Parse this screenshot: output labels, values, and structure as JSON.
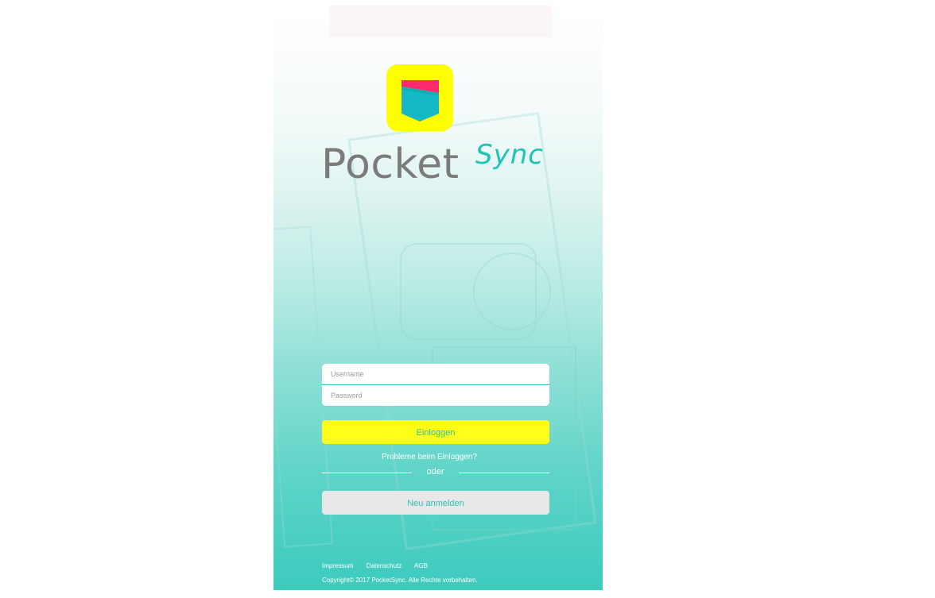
{
  "app": {
    "name_part1": "Pocket",
    "name_part2": "Sync",
    "icon": "pocket-logo-icon"
  },
  "login": {
    "username_placeholder": "Username",
    "password_placeholder": "Password",
    "login_button": "Einloggen",
    "problems_link": "Probleme beim Einloggen?",
    "separator": "oder",
    "register_button": "Neu anmelden"
  },
  "footer": {
    "links": [
      "Impressum",
      "Datenschutz",
      "AGB"
    ],
    "copyright": "Copyright© 2017 PocketSync. Alle Rechte vorbehalten."
  },
  "colors": {
    "accent": "#2bbfb2",
    "brand_yellow": "#ffff00",
    "brand_pink": "#ff2a6d",
    "wordmark_gray": "#7b7b7b"
  }
}
